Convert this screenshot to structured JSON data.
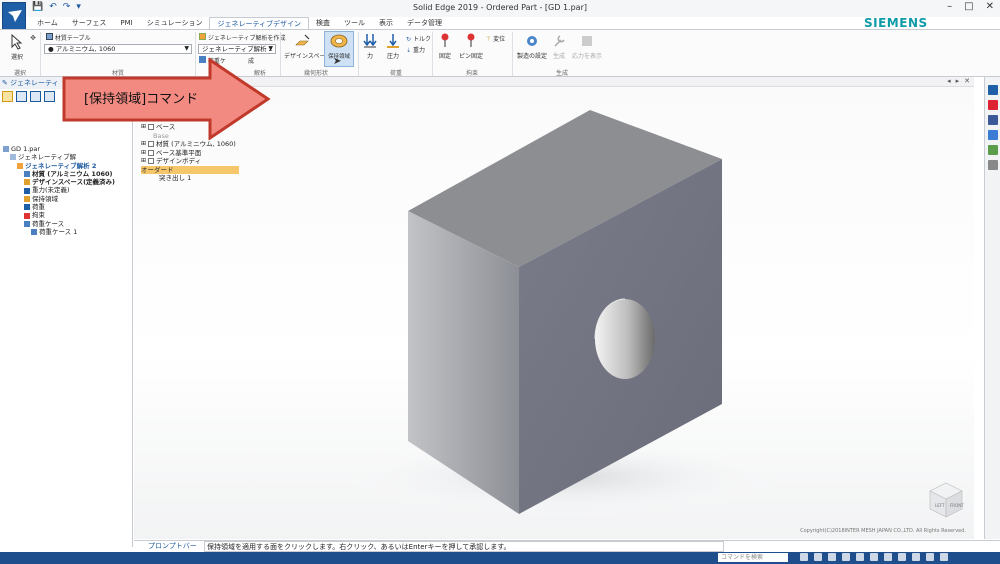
{
  "window": {
    "title": "Solid Edge 2019 - Ordered Part - [GD 1.par]",
    "qat": [
      "💾",
      "↶",
      "↷",
      "▾"
    ]
  },
  "tabs": [
    "ホーム",
    "サーフェス",
    "PMI",
    "シミュレーション",
    "ジェネレーティブデザイン",
    "検査",
    "ツール",
    "表示",
    "データ管理"
  ],
  "active_tab_index": 4,
  "brand": "SIEMENS",
  "ribbon": {
    "select_label": "選択",
    "select_group": "選択",
    "material_table": "材質テーブル",
    "material_value": "アルミニウム, 1060",
    "material_group": "材質",
    "create_study": "ジェネレーティブ解析を作成",
    "study_value": "ジェネレーティブ解析 2",
    "load_case": "荷重ケ",
    "study_group_fragment": "成",
    "analysis_group": "解析",
    "design_space": "デザインスペー",
    "preserve_region": "保持領域",
    "geometry_group": "幾何形状",
    "force": "力",
    "pressure": "圧力",
    "torque": "トルク",
    "gravity": "重力",
    "loads_group": "荷重",
    "fixed": "固定",
    "pin_fixed": "ピン固定",
    "displacement": "変位",
    "constraints_group": "拘束",
    "manufacturing": "製造の設定",
    "generate": "生成",
    "show_stress": "応力を表示",
    "generate_group": "生成"
  },
  "callout": "[保持領域]コマンド",
  "sidebar": {
    "header": "ジェネレーティ",
    "tree": [
      {
        "label": "GD 1.par",
        "indent": 0,
        "icon": "part-icon",
        "bold": false
      },
      {
        "label": "ジェネレーティブ解",
        "indent": 1,
        "icon": "study-folder-icon",
        "bold": false
      },
      {
        "label": "ジェネレーティブ解析 2",
        "indent": 2,
        "icon": "study-icon",
        "bold": true
      },
      {
        "label": "材質 (アルミニウム 1060)",
        "indent": 3,
        "icon": "material-icon",
        "bold": true
      },
      {
        "label": "デザインスペース(定義済み)",
        "indent": 3,
        "icon": "design-space-icon",
        "bold": true
      },
      {
        "label": "重力(未定義)",
        "indent": 3,
        "icon": "gravity-icon",
        "bold": false
      },
      {
        "label": "保持領域",
        "indent": 3,
        "icon": "preserve-icon",
        "bold": false
      },
      {
        "label": "荷重",
        "indent": 3,
        "icon": "load-icon",
        "bold": false
      },
      {
        "label": "拘束",
        "indent": 3,
        "icon": "constraint-icon",
        "bold": false
      },
      {
        "label": "荷重ケース",
        "indent": 3,
        "icon": "load-case-folder-icon",
        "bold": false
      },
      {
        "label": "荷重ケース 1",
        "indent": 4,
        "icon": "load-case-icon",
        "bold": false
      }
    ]
  },
  "pathfinder": {
    "rows": [
      {
        "label": "ベース",
        "checkbox": true
      },
      {
        "label": "Base",
        "checkbox": false
      },
      {
        "label": "材質 (アルミニウム, 1060)",
        "checkbox": true
      },
      {
        "label": "ベース基準平面",
        "checkbox": true
      },
      {
        "label": "デザインボディ",
        "checkbox": true
      },
      {
        "label": "オーダード",
        "checkbox": false
      },
      {
        "label": "突き出し 1",
        "checkbox": false
      }
    ]
  },
  "viewport": {
    "copyright": "Copyright(C)2018INTER MESH JAPAN CO.,LTD. All Rights Reserved.",
    "view_cube_labels": [
      "LEFT",
      "FRONT"
    ]
  },
  "prompt": {
    "label": "プロンプトバー",
    "text": "保持領域を適用する面をクリックします。右クリック、あるいはEnterキーを押して承認します。"
  },
  "status": {
    "search_placeholder": "コマンドを検索"
  },
  "colors": {
    "accent": "#1f5fa8",
    "callout_fill": "#f28a82",
    "callout_border": "#c0392b",
    "brand": "#0f9ba8",
    "highlight": "#f5c66a",
    "status_bar": "#1f4e8c"
  }
}
